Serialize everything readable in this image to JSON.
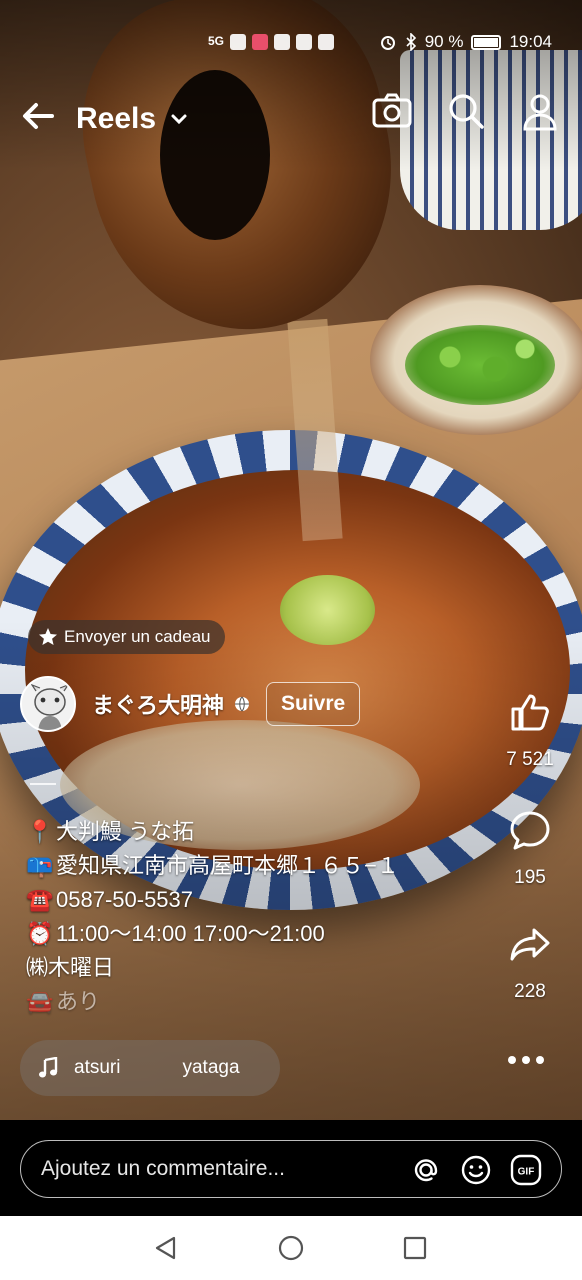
{
  "status_bar": {
    "network": "5G",
    "battery": "90 %",
    "battery_level": 0.9,
    "time": "19:04"
  },
  "header": {
    "title": "Reels"
  },
  "gift_label": "Envoyer un cadeau",
  "author": {
    "name": "まぐろ大明神",
    "follow_label": "Suivre"
  },
  "actions": {
    "likes": "7 521",
    "comments": "195",
    "shares": "228"
  },
  "caption": {
    "lines": [
      {
        "icon": "📍",
        "text": "大判鰻 うな拓"
      },
      {
        "icon": "📪",
        "text": "愛知県江南市高屋町本郷１６５−１"
      },
      {
        "icon": "☎️",
        "text": "0587-50-5537"
      },
      {
        "icon": "⏰",
        "text": "11:00〜14:00 17:00〜21:00"
      },
      {
        "icon": "",
        "text": "㈱木曜日"
      },
      {
        "icon": "🚘",
        "text": "あり"
      }
    ]
  },
  "music": {
    "track_a": "atsuri",
    "track_b": "yataga"
  },
  "comment_bar": {
    "placeholder": "Ajoutez un commentaire..."
  }
}
